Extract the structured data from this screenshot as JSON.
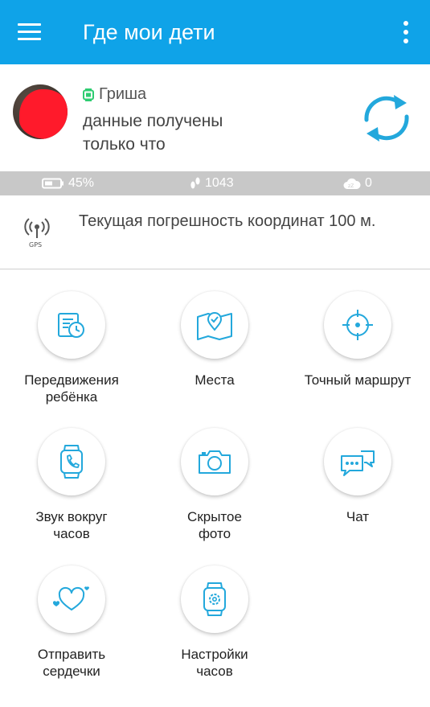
{
  "app": {
    "title": "Где мои дети"
  },
  "child": {
    "name": "Гриша",
    "status_line1": "данные получены",
    "status_line2": "только что"
  },
  "stats": {
    "battery": "45%",
    "steps": "1043",
    "sleep": "0"
  },
  "gps": {
    "icon_label": "GPS",
    "accuracy_text": "Текущая погрешность координат 100 м."
  },
  "tiles": [
    {
      "label1": "Передвижения",
      "label2": "ребёнка",
      "icon": "history-map-icon"
    },
    {
      "label1": "Места",
      "label2": "",
      "icon": "places-map-icon"
    },
    {
      "label1": "Точный маршрут",
      "label2": "",
      "icon": "crosshair-icon"
    },
    {
      "label1": "Звук вокруг",
      "label2": "часов",
      "icon": "watch-call-icon"
    },
    {
      "label1": "Скрытое",
      "label2": "фото",
      "icon": "camera-icon"
    },
    {
      "label1": "Чат",
      "label2": "",
      "icon": "chat-icon"
    },
    {
      "label1": "Отправить",
      "label2": "сердечки",
      "icon": "hearts-icon"
    },
    {
      "label1": "Настройки",
      "label2": "часов",
      "icon": "watch-settings-icon"
    }
  ],
  "colors": {
    "accent": "#0fa3e8",
    "icon": "#23a8dc",
    "stats_bg": "#c8c8c8",
    "online": "#2ecc71"
  }
}
